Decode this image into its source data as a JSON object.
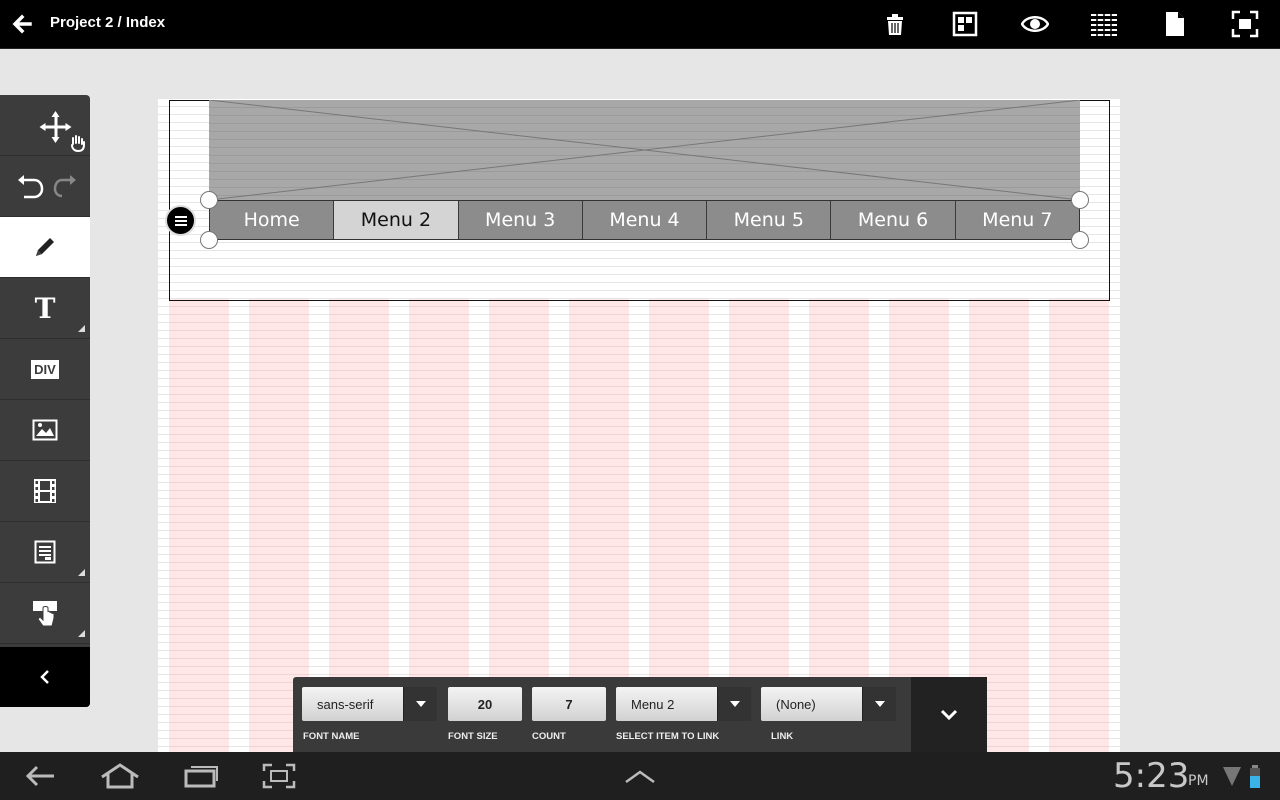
{
  "app": {
    "title": "Project 2 / Index"
  },
  "top_actions": [
    "back-arrow-icon",
    "trash-icon",
    "layout-grid-icon",
    "eye-icon",
    "table-icon",
    "document-icon",
    "fullscreen-icon"
  ],
  "left_toolbar": {
    "items": [
      "move-pan-icon",
      "undo-redo-icon",
      "pencil-icon",
      "text-icon",
      "div-icon",
      "image-icon",
      "film-icon",
      "form-icon",
      "click-touch-icon"
    ],
    "text_tool_glyph": "T",
    "div_tool_label": "DIV",
    "selected": "pencil-icon"
  },
  "navbar_widget": {
    "items": [
      "Home",
      "Menu 2",
      "Menu 3",
      "Menu 4",
      "Menu 5",
      "Menu 6",
      "Menu 7"
    ],
    "active_item": "Menu 2"
  },
  "properties": {
    "font_name": {
      "value": "sans-serif",
      "label": "FONT NAME"
    },
    "font_size": {
      "value": "20",
      "label": "FONT SIZE"
    },
    "count": {
      "value": "7",
      "label": "COUNT"
    },
    "select_item_to_link": {
      "value": "Menu 2",
      "label": "SELECT ITEM TO LINK"
    },
    "link": {
      "value": "(None)",
      "label": "LINK"
    }
  },
  "system": {
    "time": "5:23",
    "ampm": "PM"
  },
  "colors": {
    "top_bar": "#000000",
    "left_toolbar": "#3c3c3c",
    "grid_column": "#ffe0e0",
    "nav_item": "#8c8c8c",
    "nav_active": "#d4d4d4"
  }
}
